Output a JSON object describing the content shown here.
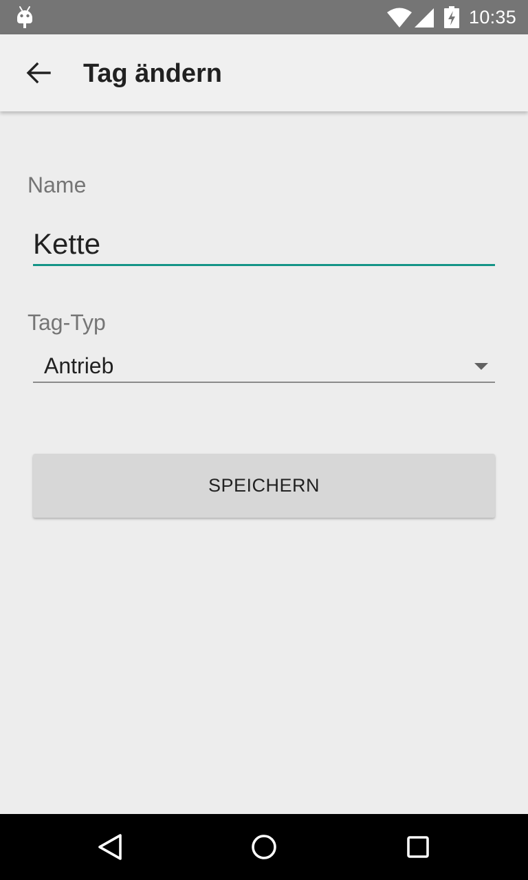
{
  "status_bar": {
    "time": "10:35",
    "icons": [
      "android-icon",
      "wifi-icon",
      "signal-icon",
      "battery-charging-icon"
    ]
  },
  "toolbar": {
    "back_icon": "arrow-back-icon",
    "title": "Tag ändern"
  },
  "form": {
    "name": {
      "label": "Name",
      "value": "Kette"
    },
    "tag_type": {
      "label": "Tag-Typ",
      "selected": "Antrieb"
    },
    "save_label": "SPEICHERN"
  },
  "nav_bar": {
    "icons": [
      "nav-back-icon",
      "nav-home-icon",
      "nav-recents-icon"
    ]
  },
  "colors": {
    "accent": "#139487",
    "status_bar": "#757575",
    "toolbar": "#f0f0f0",
    "background": "#ededed",
    "button": "#d7d7d7"
  }
}
